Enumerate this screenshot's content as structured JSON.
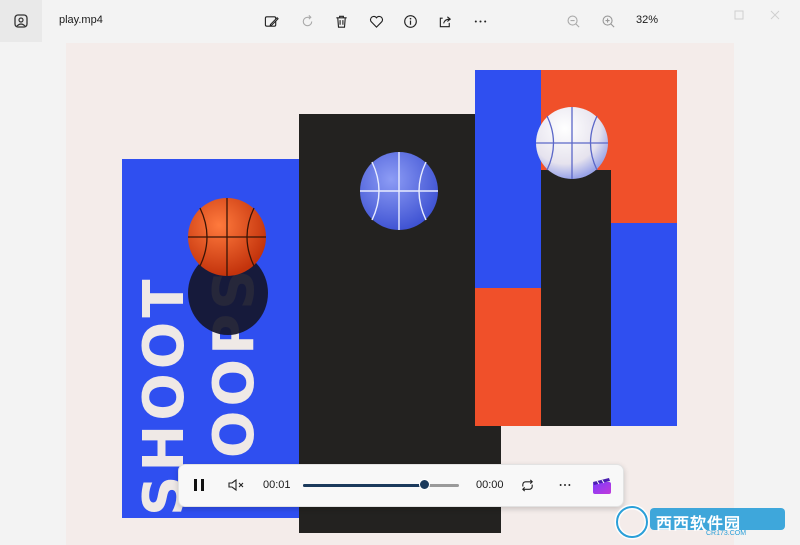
{
  "titlebar": {
    "app_icon": "photos-app-icon",
    "filename": "play.mp4",
    "zoom_label": "32%"
  },
  "toolbar": {
    "icons": [
      "edit-image-icon",
      "rotate-icon",
      "delete-icon",
      "favorite-icon",
      "info-icon",
      "share-icon",
      "more-icon",
      "zoom-out-icon",
      "zoom-in-icon"
    ]
  },
  "artwork": {
    "vertical_text_top": "SHOOT",
    "vertical_text_bottom": "HOOPS",
    "colors": {
      "blue": "#2f4ff0",
      "orange": "#f0502a",
      "dark": "#232220",
      "background": "#f4ecea"
    }
  },
  "player": {
    "current_time": "00:01",
    "remaining_time": "00:00",
    "progress": 0.78,
    "icons": [
      "pause-icon",
      "mute-icon",
      "repeat-icon",
      "more-icon",
      "clipchamp-icon"
    ]
  },
  "watermark": {
    "brand_text": "西西软件园",
    "site_text": "CR173.COM"
  }
}
